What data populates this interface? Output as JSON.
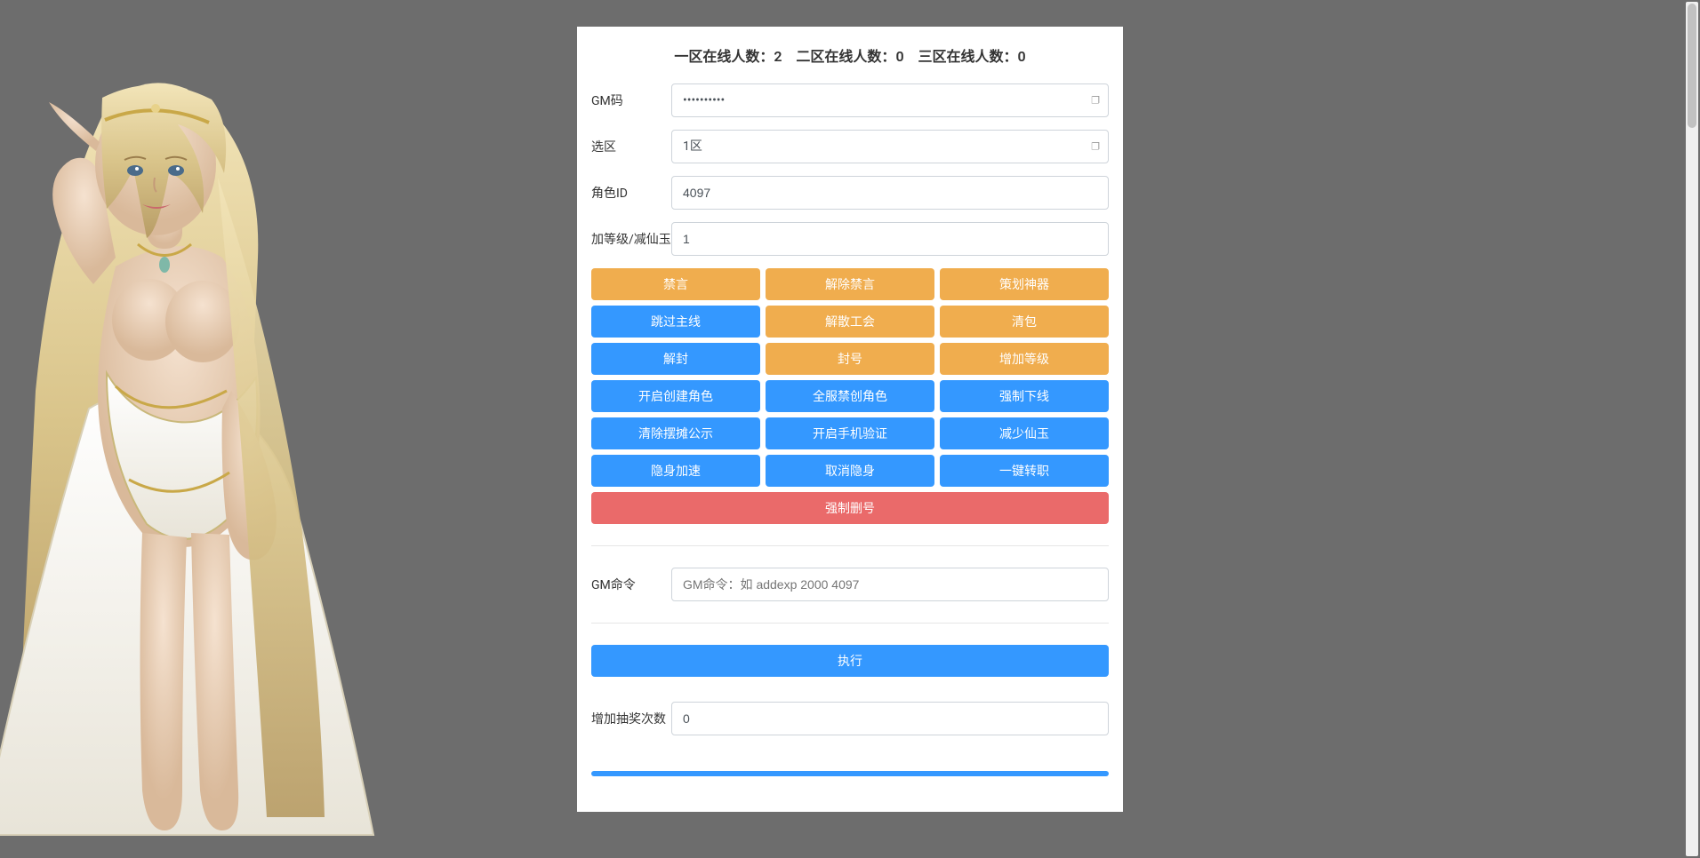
{
  "header": {
    "zone1_label": "一区在线人数：",
    "zone1_count": "2",
    "zone2_label": "二区在线人数：",
    "zone2_count": "0",
    "zone3_label": "三区在线人数：",
    "zone3_count": "0"
  },
  "form": {
    "gm_code_label": "GM码",
    "gm_code_value": "••••••••••",
    "zone_label": "选区",
    "zone_value": "1区",
    "role_id_label": "角色ID",
    "role_id_value": "4097",
    "level_label": "加等级/减仙玉",
    "level_value": "1"
  },
  "buttons": {
    "row1": [
      "禁言",
      "解除禁言",
      "策划神器"
    ],
    "row2": [
      "跳过主线",
      "解散工会",
      "清包"
    ],
    "row3": [
      "解封",
      "封号",
      "增加等级"
    ],
    "row4": [
      "开启创建角色",
      "全服禁创角色",
      "强制下线"
    ],
    "row5": [
      "清除摆摊公示",
      "开启手机验证",
      "减少仙玉"
    ],
    "row6": [
      "隐身加速",
      "取消隐身",
      "一键转职"
    ],
    "force_delete": "强制删号",
    "execute": "执行"
  },
  "gm_command": {
    "label": "GM命令",
    "placeholder": "GM命令：如 addexp 2000 4097"
  },
  "lottery": {
    "label": "增加抽奖次数",
    "value": "0"
  }
}
